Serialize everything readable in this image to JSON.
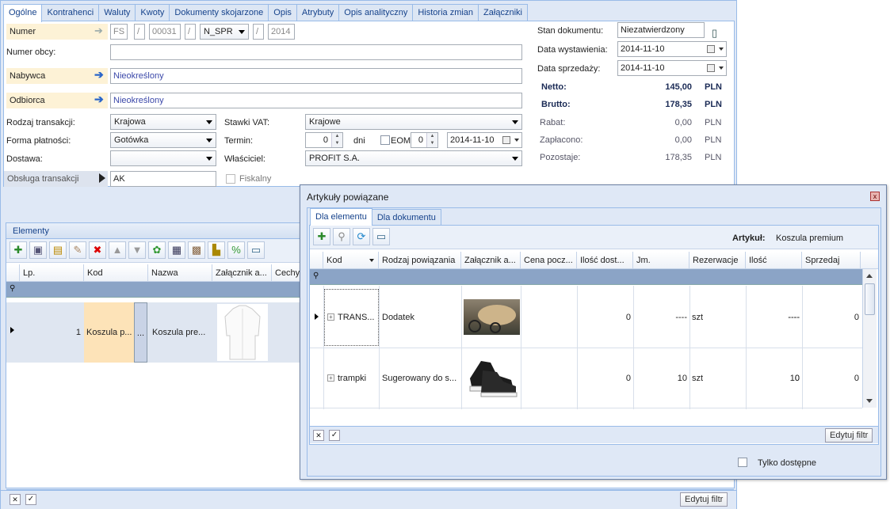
{
  "main": {
    "tabs": [
      "Ogólne",
      "Kontrahenci",
      "Waluty",
      "Kwoty",
      "Dokumenty skojarzone",
      "Opis",
      "Atrybuty",
      "Opis analityczny",
      "Historia zmian",
      "Załączniki"
    ],
    "numer": {
      "label": "Numer",
      "p1": "FS",
      "sep1": "/",
      "p2": "00031",
      "sep2": "/",
      "p3": "N_SPR",
      "sep3": "/",
      "p4": "2014"
    },
    "numer_obcy": {
      "label": "Numer obcy:",
      "value": ""
    },
    "nabywca": {
      "label": "Nabywca",
      "value": "Nieokreślony"
    },
    "odbiorca": {
      "label": "Odbiorca",
      "value": "Nieokreślony"
    },
    "rodzaj": {
      "label": "Rodzaj transakcji:",
      "value": "Krajowa"
    },
    "forma": {
      "label": "Forma płatności:",
      "value": "Gotówka"
    },
    "dostawa": {
      "label": "Dostawa:",
      "value": ""
    },
    "obsluga": {
      "label": "Obsługa transakcji",
      "value": "AK"
    },
    "stawki": {
      "label": "Stawki VAT:",
      "value": "Krajowe"
    },
    "termin": {
      "label": "Termin:",
      "value": "0",
      "dni": "dni",
      "eom": "EOM",
      "eom_val": "0",
      "date": "2014-11-10"
    },
    "wlasciciel": {
      "label": "Właściciel:",
      "value": "PROFIT S.A."
    },
    "fiskalny": {
      "label": "Fiskalny"
    },
    "stan": {
      "label": "Stan dokumentu:",
      "value": "Niezatwierdzony"
    },
    "data_wyst": {
      "label": "Data wystawienia:",
      "value": "2014-11-10"
    },
    "data_sprz": {
      "label": "Data sprzedaży:",
      "value": "2014-11-10"
    },
    "summary": [
      {
        "label": "Netto:",
        "value": "145,00",
        "cur": "PLN",
        "bold": true
      },
      {
        "label": "Brutto:",
        "value": "178,35",
        "cur": "PLN",
        "bold": true
      },
      {
        "label": "Rabat:",
        "value": "0,00",
        "cur": "PLN",
        "bold": false
      },
      {
        "label": "Zapłacono:",
        "value": "0,00",
        "cur": "PLN",
        "bold": false
      },
      {
        "label": "Pozostaje:",
        "value": "178,35",
        "cur": "PLN",
        "bold": false
      }
    ]
  },
  "elements": {
    "title": "Elementy",
    "columns": [
      "Lp.",
      "Kod",
      "Nazwa",
      "Załącznik a...",
      "Cechy"
    ],
    "row": {
      "lp": "1",
      "kod": "Koszula p...",
      "dots": "...",
      "nazwa": "Koszula pre..."
    },
    "edit_filter": "Edytuj filtr"
  },
  "popup": {
    "title": "Artykuły powiązane",
    "close": "x",
    "tabs": [
      "Dla elementu",
      "Dla dokumentu"
    ],
    "artykul_label": "Artykuł:",
    "artykul_value": "Koszula premium",
    "columns": [
      "Kod",
      "Rodzaj powiązania",
      "Załącznik a...",
      "Cena pocz...",
      "Ilość dost...",
      "Jm.",
      "Rezerwacje",
      "Ilość",
      "Sprzedaj"
    ],
    "rows": [
      {
        "kod": "TRANS...",
        "rodzaj": "Dodatek",
        "cena": "0",
        "ilosc_dost": "----",
        "jm": "szt",
        "rez": "----",
        "ilosc": "----",
        "sprzedaj": "0"
      },
      {
        "kod": "trampki",
        "rodzaj": "Sugerowany do s...",
        "cena": "0",
        "ilosc_dost": "10",
        "jm": "szt",
        "rez": "0",
        "ilosc": "10",
        "sprzedaj": "0"
      }
    ],
    "edit_filter": "Edytuj filtr",
    "tylko": "Tylko dostępne"
  }
}
